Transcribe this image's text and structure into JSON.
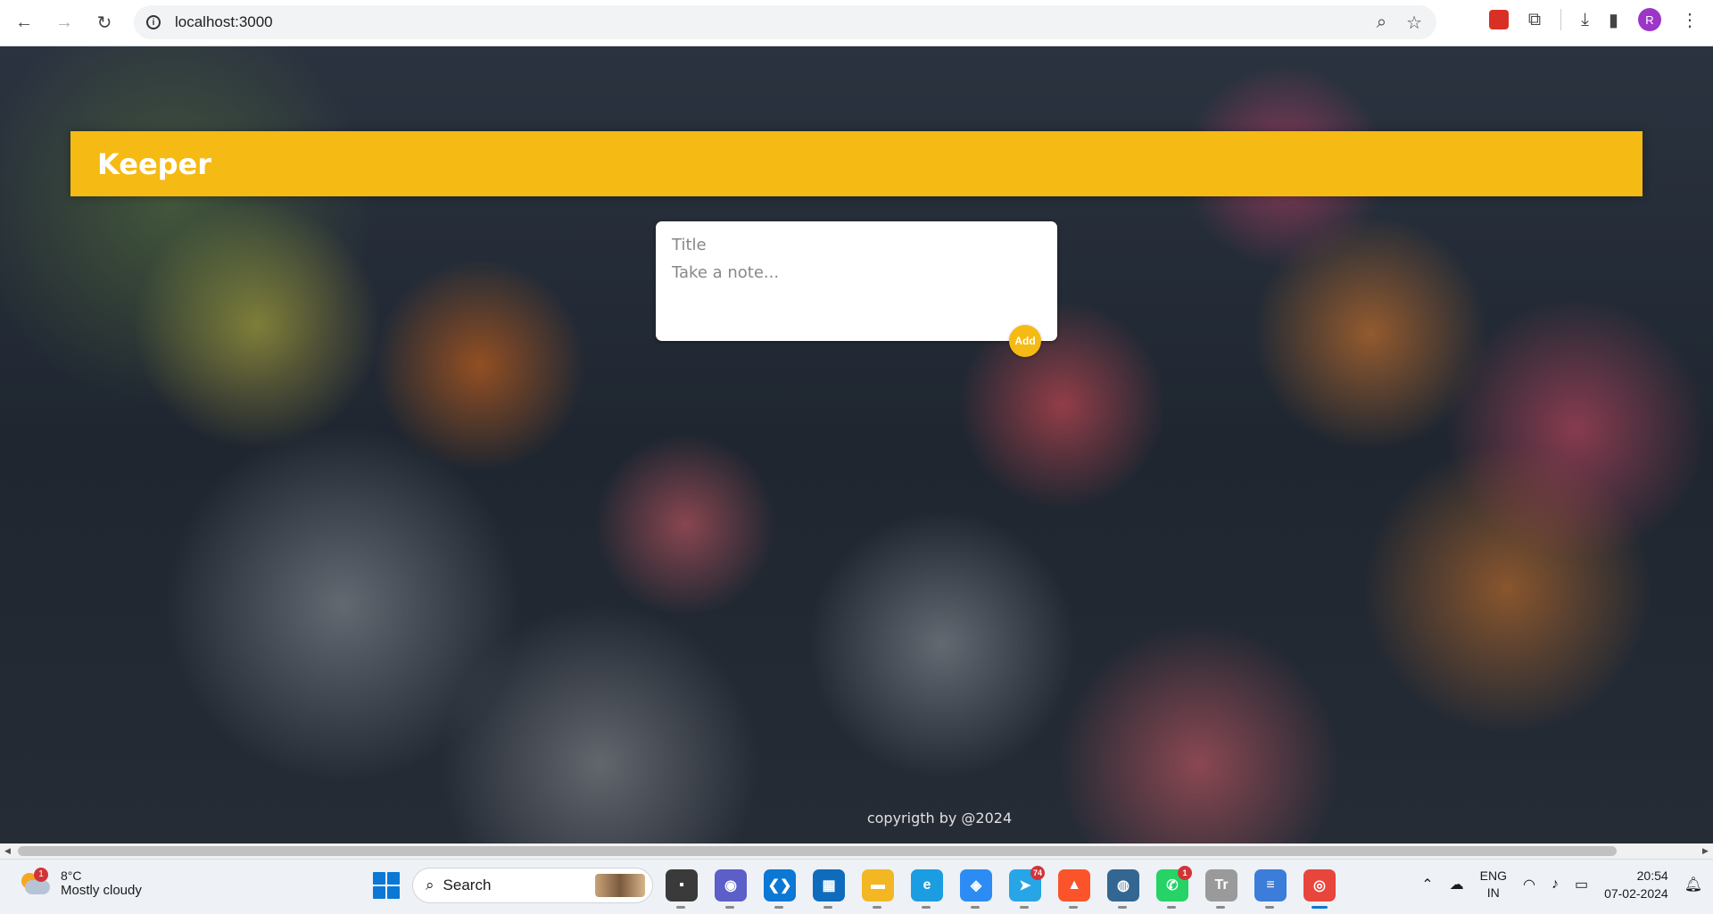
{
  "browser": {
    "url": "localhost:3000",
    "profile_initial": "R"
  },
  "app": {
    "title": "Keeper",
    "form": {
      "title_placeholder": "Title",
      "content_placeholder": "Take a note...",
      "add_label": "Add"
    },
    "footer": "copyrigth by @2024"
  },
  "taskbar": {
    "weather": {
      "temp": "8°C",
      "condition": "Mostly cloudy",
      "badge": "1"
    },
    "search_label": "Search",
    "apps": [
      {
        "name": "file-explorer-dark",
        "color": "#3a3a3a",
        "glyph": "▪"
      },
      {
        "name": "teams",
        "color": "#5b5fc7",
        "glyph": "◉"
      },
      {
        "name": "vscode",
        "color": "#0a78d4",
        "glyph": "❮❯"
      },
      {
        "name": "ms-store",
        "color": "#0f6cbd",
        "glyph": "▦"
      },
      {
        "name": "file-explorer",
        "color": "#f2b722",
        "glyph": "▬"
      },
      {
        "name": "edge",
        "color": "#1b9de2",
        "glyph": "e"
      },
      {
        "name": "app-blue",
        "color": "#2c8cf4",
        "glyph": "◈"
      },
      {
        "name": "telegram",
        "color": "#27a5e7",
        "glyph": "➤",
        "count": "74"
      },
      {
        "name": "brave",
        "color": "#fb542b",
        "glyph": "▲"
      },
      {
        "name": "postgresql",
        "color": "#336791",
        "glyph": "◍"
      },
      {
        "name": "whatsapp",
        "color": "#25d366",
        "glyph": "✆",
        "count": "1"
      },
      {
        "name": "typora",
        "color": "#9a9a9a",
        "glyph": "Tr"
      },
      {
        "name": "notepad",
        "color": "#3b7dd8",
        "glyph": "≡"
      },
      {
        "name": "chrome",
        "color": "#e8453c",
        "glyph": "◎",
        "active": true
      }
    ],
    "lang": {
      "line1": "ENG",
      "line2": "IN"
    },
    "time": "20:54",
    "date": "07-02-2024"
  }
}
